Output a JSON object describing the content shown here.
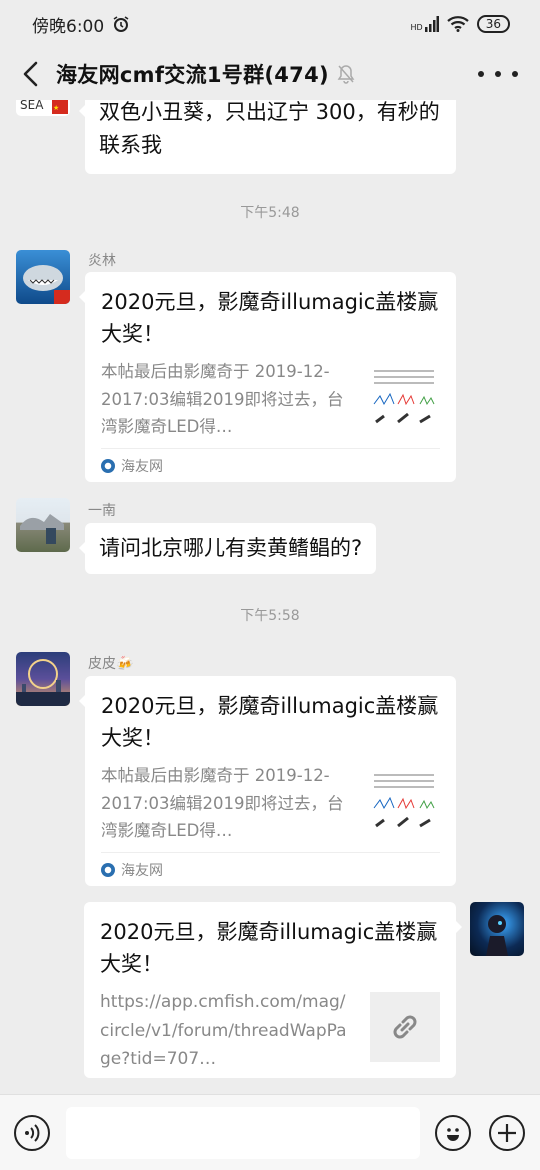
{
  "statusbar": {
    "time": "傍晚6:00",
    "signal": "HD",
    "battery": "36"
  },
  "header": {
    "title": "海友网cmf交流1号群(474)"
  },
  "messages": [
    {
      "type": "text",
      "text": "双色小丑葵，只出辽宁 300，有秒的联系我"
    },
    {
      "type": "timestamp",
      "text": "下午5:48"
    },
    {
      "type": "card",
      "sender": "炎林",
      "title": "2020元旦，影魔奇illumagic盖楼赢大奖！",
      "desc": "本帖最后由影魔奇于 2019-12-2017:03编辑2019即将过去，台湾影魔奇LED得…",
      "source": "海友网"
    },
    {
      "type": "text",
      "sender": "一南",
      "text": "请问北京哪儿有卖黄鳍鲳的?"
    },
    {
      "type": "timestamp",
      "text": "下午5:58"
    },
    {
      "type": "card",
      "sender": "皮皮🍻",
      "title": "2020元旦，影魔奇illumagic盖楼赢大奖！",
      "desc": "本帖最后由影魔奇于 2019-12-2017:03编辑2019即将过去，台湾影魔奇LED得…",
      "source": "海友网"
    },
    {
      "type": "link",
      "title": "2020元旦，影魔奇illumagic盖楼赢大奖！",
      "url": "https://app.cmfish.com/mag/circle/v1/forum/threadWapPage?tid=707…"
    }
  ],
  "composer": {
    "placeholder": ""
  }
}
